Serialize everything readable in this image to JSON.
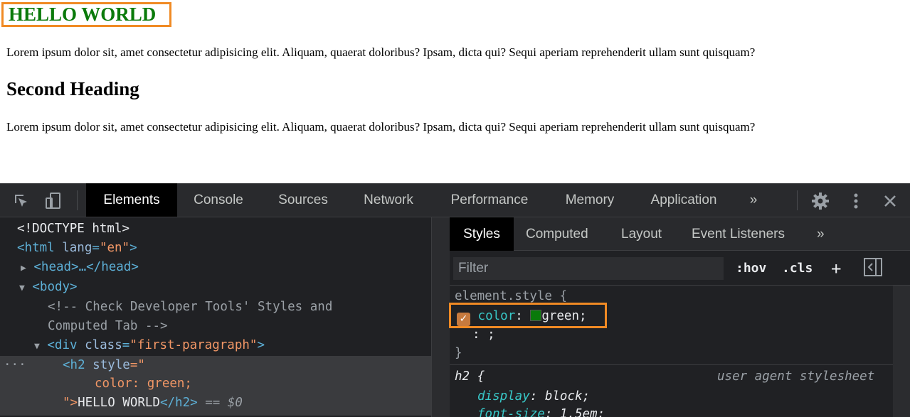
{
  "page": {
    "heading1": "HELLO WORLD",
    "para1": "Lorem ipsum dolor sit, amet consectetur adipisicing elit. Aliquam, quaerat doloribus? Ipsam, dicta qui? Sequi aperiam reprehenderit ullam sunt quisquam?",
    "heading2": "Second Heading",
    "para2": "Lorem ipsum dolor sit, amet consectetur adipisicing elit. Aliquam, quaerat doloribus? Ipsam, dicta qui? Sequi aperiam reprehenderit ullam sunt quisquam?",
    "heading1_color": "#0a7a0a",
    "highlight_color": "#f08a24"
  },
  "devtools": {
    "tabs": {
      "elements": "Elements",
      "console": "Console",
      "sources": "Sources",
      "network": "Network",
      "performance": "Performance",
      "memory": "Memory",
      "application": "Application",
      "more": "»"
    },
    "icons": {
      "inspect": "inspect-icon",
      "device": "device-toggle-icon",
      "settings": "gear-icon",
      "menu": "kebab-menu-icon",
      "close": "close-icon"
    },
    "elements_tree": {
      "doctype": "<!DOCTYPE html>",
      "html_open": "<html",
      "html_attr": "lang",
      "html_val": "\"en\"",
      "html_close_bracket": ">",
      "head": "<head>…</head>",
      "body_open": "<body>",
      "comment_line1": "<!-- Check Developer Tools' Styles and",
      "comment_line2": "Computed Tab -->",
      "div_open": "<div",
      "div_attr": "class",
      "div_val": "\"first-paragraph\"",
      "div_close_bracket": ">",
      "ellipsis": "···",
      "h2_open": "<h2",
      "h2_attr": "style",
      "h2_val_open": "=\"",
      "h2_style_text": "color: green;",
      "h2_val_close": "\">",
      "h2_text": "HELLO WORLD",
      "h2_close": "</h2>",
      "eq": "==",
      "dollar": "$0"
    },
    "styles_pane": {
      "subtabs": {
        "styles": "Styles",
        "computed": "Computed",
        "layout": "Layout",
        "event_listeners": "Event Listeners",
        "more": "»"
      },
      "filter_placeholder": "Filter",
      "hov": ":hov",
      "cls": ".cls",
      "plus": "+",
      "element_style_selector": "element.style {",
      "color_prop": "color",
      "color_value": "green;",
      "empty_line": ": ;",
      "close_brace": "}",
      "h2_selector": "h2 {",
      "ua_label": "user agent stylesheet",
      "display_prop": "display",
      "display_value": "block;",
      "font_size_prop": "font-size",
      "font_size_value": "1.5em;"
    }
  }
}
